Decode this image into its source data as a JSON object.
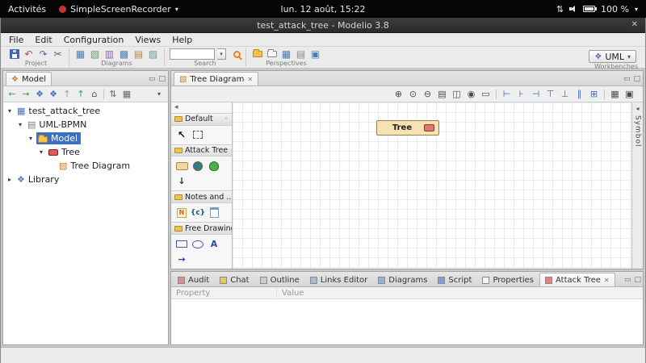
{
  "desktop": {
    "activities": "Activités",
    "app_menu": "SimpleScreenRecorder",
    "clock": "lun. 12 août, 15:22",
    "battery": "100 %"
  },
  "window": {
    "title": "test_attack_tree - Modelio 3.8"
  },
  "menubar": [
    "File",
    "Edit",
    "Configuration",
    "Views",
    "Help"
  ],
  "toolbar": {
    "groups": {
      "project": "Project",
      "diagrams": "Diagrams",
      "search": "Search",
      "perspectives": "Perspectives",
      "workbenches": "Workbenches"
    },
    "search_value": "",
    "workbench_selected": "UML",
    "diagram_icons": [
      "▦",
      "▧",
      "▥",
      "▩",
      "▤",
      "▨"
    ]
  },
  "model_panel": {
    "tab_label": "Model",
    "tree": [
      {
        "label": "test_attack_tree"
      },
      {
        "label": "UML-BPMN"
      },
      {
        "label": "Model",
        "selected": true
      },
      {
        "label": "Tree"
      },
      {
        "label": "Tree Diagram"
      },
      {
        "label": "Library"
      }
    ]
  },
  "editor": {
    "tab_label": "Tree Diagram",
    "palette": {
      "sections": [
        {
          "label": "Default",
          "items": [
            "selection-tool",
            "marquee-tool"
          ]
        },
        {
          "label": "Attack Tree",
          "items": [
            "and-node",
            "or-node",
            "leaf-node",
            "transition"
          ]
        },
        {
          "label": "Notes and ...",
          "items": [
            "note",
            "constraint",
            "external-document"
          ]
        },
        {
          "label": "Free Drawing",
          "items": [
            "rectangle",
            "ellipse",
            "text",
            "line"
          ]
        }
      ]
    },
    "canvas": {
      "node_label": "Tree"
    },
    "symbol_tab": "Symbol"
  },
  "bottom_panel": {
    "tabs": [
      {
        "label": "Audit"
      },
      {
        "label": "Chat"
      },
      {
        "label": "Outline"
      },
      {
        "label": "Links Editor"
      },
      {
        "label": "Diagrams"
      },
      {
        "label": "Script"
      },
      {
        "label": "Properties"
      },
      {
        "label": "Attack Tree",
        "active": true
      }
    ],
    "table": {
      "columns": [
        "Property",
        "Value"
      ]
    }
  },
  "colors": {
    "selection": "#3d6fc4",
    "node_fill": "#f6e2b2",
    "node_badge": "#e27474",
    "folder": "#f0c24e"
  },
  "icons": {
    "caret": "▾",
    "close": "✕",
    "minimize": "▭",
    "maximize": "□",
    "back": "←",
    "forward": "→",
    "up": "↑",
    "home": "⌂",
    "diamond": "❖",
    "undo": "↶",
    "redo": "↷",
    "scissors": "✂",
    "updown": "⇅",
    "zoom_in": "⊕",
    "zoom_level": "⊙",
    "zoom_out": "⊖",
    "print": "▤",
    "save_image": "◫",
    "camera": "◉",
    "select": "▭",
    "align_left": "⊢",
    "align_center": "⊦",
    "align_right": "⊣",
    "align_top": "⊤",
    "align_bottom": "⊥",
    "distribute": "∥",
    "same_size": "⊞",
    "grid": "▦",
    "snap": "▣",
    "down_arrow": "↓",
    "right_arrow": "→",
    "letter_a": "A",
    "letter_n": "N",
    "constraint": "{c}",
    "cursor": "↖",
    "collapse_left": "◂",
    "pin": "◦",
    "twisty_open": "▾",
    "twisty_closed": "▸",
    "diagram_page": "▧",
    "project": "▦",
    "uml_project": "▤",
    "library": "❖"
  }
}
